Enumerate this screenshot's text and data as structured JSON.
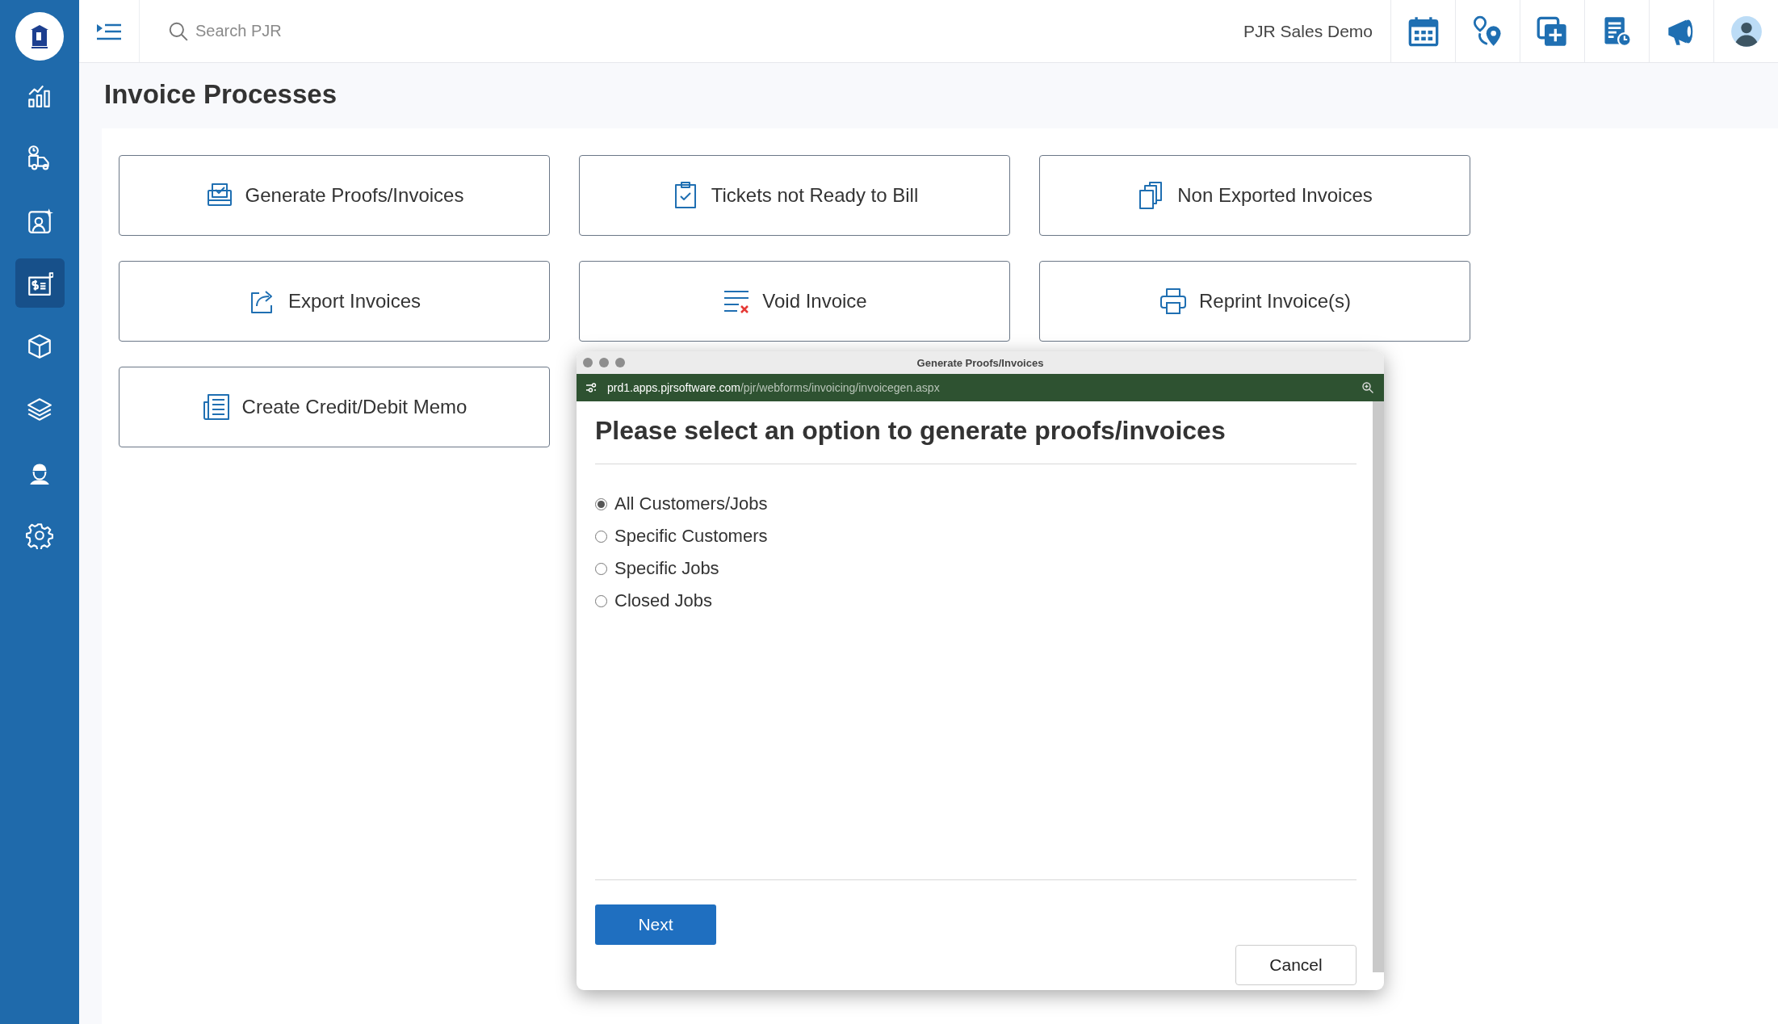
{
  "sidebar": {
    "items": [
      {
        "kind": "chart",
        "selected": false
      },
      {
        "kind": "truck",
        "selected": false
      },
      {
        "kind": "contact",
        "selected": false
      },
      {
        "kind": "invoice",
        "selected": true
      },
      {
        "kind": "box",
        "selected": false
      },
      {
        "kind": "layers",
        "selected": false
      },
      {
        "kind": "worker",
        "selected": false
      },
      {
        "kind": "gear",
        "selected": false
      }
    ]
  },
  "top_bar": {
    "search": {
      "placeholder": "Search PJR"
    },
    "company": "PJR Sales Demo",
    "actions": [
      {
        "kind": "calendar"
      },
      {
        "kind": "route"
      },
      {
        "kind": "add"
      },
      {
        "kind": "report"
      },
      {
        "kind": "megaphone"
      },
      {
        "kind": "avatar"
      }
    ]
  },
  "page": {
    "title": "Invoice Processes",
    "cards": [
      {
        "kind": "generate",
        "label": "Generate Proofs/Invoices"
      },
      {
        "kind": "ticket",
        "label": "Tickets not Ready to Bill"
      },
      {
        "kind": "copies",
        "label": "Non Exported Invoices"
      },
      {
        "kind": "export",
        "label": "Export Invoices"
      },
      {
        "kind": "void",
        "label": "Void Invoice"
      },
      {
        "kind": "print",
        "label": "Reprint Invoice(s)"
      },
      {
        "kind": "memo",
        "label": "Create Credit/Debit Memo"
      }
    ]
  },
  "dialog": {
    "window_title": "Generate Proofs/Invoices",
    "url_host": "prd1.apps.pjrsoftware.com",
    "url_path": "/pjr/webforms/invoicing/invoicegen.aspx",
    "heading": "Please select an option to generate proofs/invoices",
    "options": [
      {
        "label": "All Customers/Jobs",
        "selected": true
      },
      {
        "label": "Specific Customers",
        "selected": false
      },
      {
        "label": "Specific Jobs",
        "selected": false
      },
      {
        "label": "Closed Jobs",
        "selected": false
      }
    ],
    "buttons": {
      "next": "Next",
      "cancel": "Cancel"
    }
  }
}
